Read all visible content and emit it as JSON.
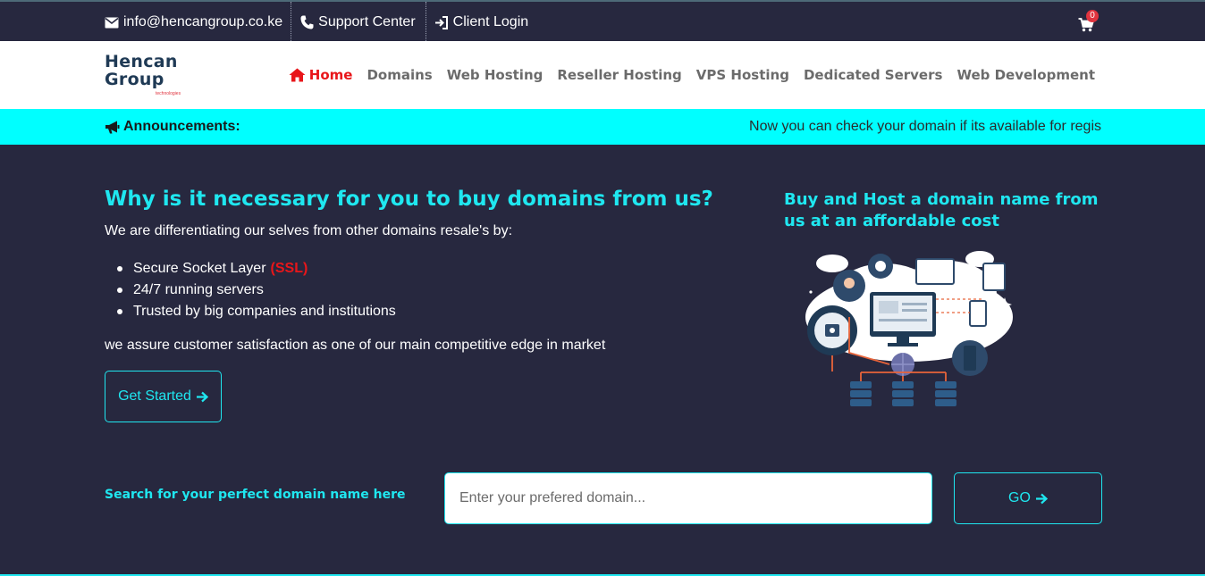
{
  "topbar": {
    "email": "info@hencangroup.co.ke",
    "support": "Support Center",
    "login": "Client Login",
    "cart_count": "0"
  },
  "logo": {
    "line1": "Hencan",
    "line2": "Group",
    "tagline": "technologies"
  },
  "nav": {
    "items": [
      "Home",
      "Domains",
      "Web Hosting",
      "Reseller Hosting",
      "VPS Hosting",
      "Dedicated Servers",
      "Web Development"
    ]
  },
  "announcement": {
    "label": "Announcements:",
    "text": "Now you can check your domain if its available for regis"
  },
  "hero": {
    "title": "Why is it necessary for you to buy domains from us?",
    "intro": "We are differentiating our selves from other domains resale's by:",
    "features": [
      "Secure Socket Layer",
      "24/7 running servers",
      "Trusted by big companies and institutions"
    ],
    "ssl_tag": "(SSL)",
    "assurance": "we assure customer satisfaction as one of our main competitive edge in market",
    "cta": "Get Started",
    "side_title": "Buy and Host a domain name from us at an affordable cost"
  },
  "search": {
    "label": "Search for your perfect domain name here",
    "placeholder": "Enter your prefered domain...",
    "button": "GO"
  },
  "colors": {
    "background": "#27283f",
    "accent": "#1fe7f0",
    "announcement_bg": "#00ffff",
    "active_nav": "#e8161a"
  },
  "icons": [
    "envelope-icon",
    "phone-icon",
    "sign-in-icon",
    "cart-icon",
    "home-icon",
    "bullhorn-icon",
    "arrow-right-icon"
  ]
}
